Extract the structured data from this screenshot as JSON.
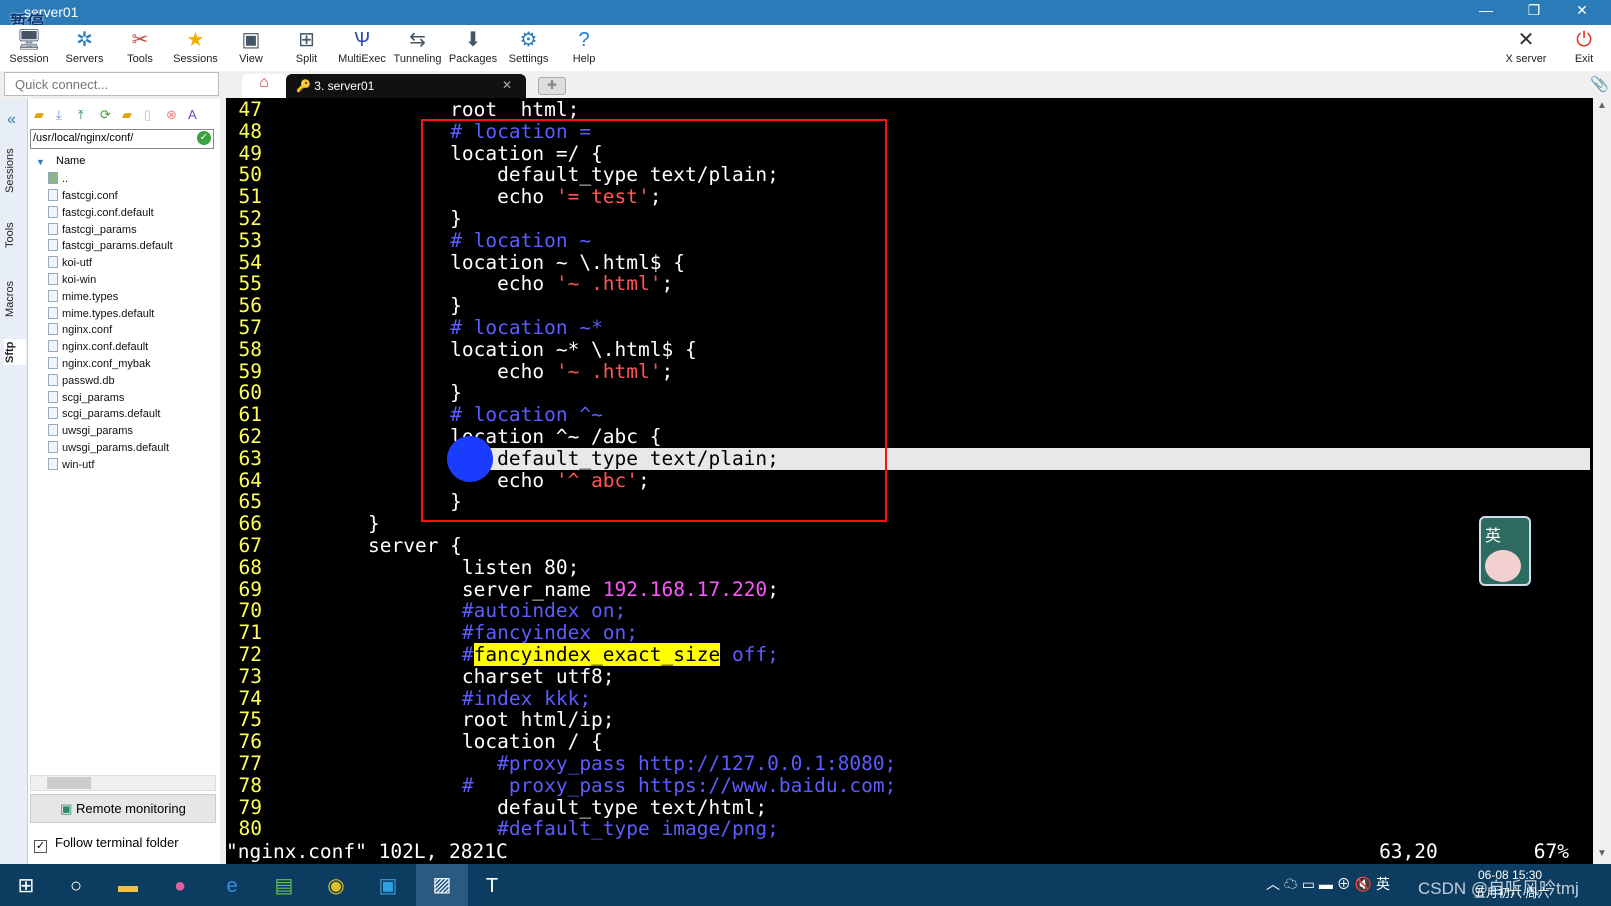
{
  "window": {
    "title": "server01",
    "overlay": "暂停"
  },
  "toolbar": {
    "items": [
      {
        "label": "Session",
        "icon": "session-icon"
      },
      {
        "label": "Servers",
        "icon": "servers-icon"
      },
      {
        "label": "Tools",
        "icon": "tools-icon"
      },
      {
        "label": "Sessions",
        "icon": "star-icon"
      },
      {
        "label": "View",
        "icon": "view-icon"
      },
      {
        "label": "Split",
        "icon": "split-icon"
      },
      {
        "label": "MultiExec",
        "icon": "multiexec-icon"
      },
      {
        "label": "Tunneling",
        "icon": "tunneling-icon"
      },
      {
        "label": "Packages",
        "icon": "packages-icon"
      },
      {
        "label": "Settings",
        "icon": "gear-icon"
      },
      {
        "label": "Help",
        "icon": "help-icon"
      }
    ],
    "xserver": "X server",
    "exit": "Exit"
  },
  "quick_connect": {
    "placeholder": "Quick connect..."
  },
  "tabs": {
    "active": "3. server01"
  },
  "vtabs": [
    "Sessions",
    "Tools",
    "Macros",
    "Sftp"
  ],
  "sftp": {
    "path": "/usr/local/nginx/conf/",
    "column": "Name",
    "parent": "..",
    "files": [
      "fastcgi.conf",
      "fastcgi.conf.default",
      "fastcgi_params",
      "fastcgi_params.default",
      "koi-utf",
      "koi-win",
      "mime.types",
      "mime.types.default",
      "nginx.conf",
      "nginx.conf.default",
      "nginx.conf_mybak",
      "passwd.db",
      "scgi_params",
      "scgi_params.default",
      "uwsgi_params",
      "uwsgi_params.default",
      "win-utf"
    ],
    "remote_monitoring": "Remote monitoring",
    "follow_terminal": "Follow terminal folder",
    "follow_checked": true
  },
  "terminal": {
    "lines": [
      {
        "n": "47",
        "seg": [
          [
            "       root  html;",
            ""
          ]
        ]
      },
      {
        "n": "48",
        "seg": [
          [
            "       ",
            ""
          ],
          [
            "# location =",
            "c"
          ]
        ]
      },
      {
        "n": "49",
        "seg": [
          [
            "       location =/ {",
            ""
          ]
        ]
      },
      {
        "n": "50",
        "seg": [
          [
            "           default_type text/plain;",
            ""
          ]
        ]
      },
      {
        "n": "51",
        "seg": [
          [
            "           echo ",
            ""
          ],
          [
            "'= test'",
            "s"
          ],
          [
            ";",
            ""
          ]
        ]
      },
      {
        "n": "52",
        "seg": [
          [
            "       }",
            ""
          ]
        ]
      },
      {
        "n": "53",
        "seg": [
          [
            "       ",
            ""
          ],
          [
            "# location ~",
            "c"
          ]
        ]
      },
      {
        "n": "54",
        "seg": [
          [
            "       location ~ \\.html$ {",
            ""
          ]
        ]
      },
      {
        "n": "55",
        "seg": [
          [
            "           echo ",
            ""
          ],
          [
            "'~ .html'",
            "s"
          ],
          [
            ";",
            ""
          ]
        ]
      },
      {
        "n": "56",
        "seg": [
          [
            "       }",
            ""
          ]
        ]
      },
      {
        "n": "57",
        "seg": [
          [
            "       ",
            ""
          ],
          [
            "# location ~*",
            "c"
          ]
        ]
      },
      {
        "n": "58",
        "seg": [
          [
            "       location ~* \\.html$ {",
            ""
          ]
        ]
      },
      {
        "n": "59",
        "seg": [
          [
            "           echo ",
            ""
          ],
          [
            "'~ .html'",
            "s"
          ],
          [
            ";",
            ""
          ]
        ]
      },
      {
        "n": "60",
        "seg": [
          [
            "       }",
            ""
          ]
        ]
      },
      {
        "n": "61",
        "seg": [
          [
            "       ",
            ""
          ],
          [
            "# location ^~",
            "c"
          ]
        ]
      },
      {
        "n": "62",
        "seg": [
          [
            "       location ^~ /abc {",
            ""
          ]
        ]
      },
      {
        "n": "63",
        "seg": [
          [
            "           default_type text/plain;",
            ""
          ]
        ],
        "cursor": true
      },
      {
        "n": "64",
        "seg": [
          [
            "           echo ",
            ""
          ],
          [
            "'^ abc'",
            "s"
          ],
          [
            ";",
            ""
          ]
        ]
      },
      {
        "n": "65",
        "seg": [
          [
            "       }",
            ""
          ]
        ]
      },
      {
        "n": "66",
        "seg": [
          [
            "}",
            ""
          ]
        ]
      },
      {
        "n": "67",
        "seg": [
          [
            "server {",
            ""
          ]
        ]
      },
      {
        "n": "68",
        "seg": [
          [
            "        listen 80;",
            ""
          ]
        ]
      },
      {
        "n": "69",
        "seg": [
          [
            "        server_name ",
            ""
          ],
          [
            "192.168.17.220",
            "m"
          ],
          [
            ";",
            ""
          ]
        ]
      },
      {
        "n": "70",
        "seg": [
          [
            "        ",
            ""
          ],
          [
            "#autoindex on;",
            "c"
          ]
        ]
      },
      {
        "n": "71",
        "seg": [
          [
            "        ",
            ""
          ],
          [
            "#fancyindex on;",
            "c"
          ]
        ]
      },
      {
        "n": "72",
        "seg": [
          [
            "        ",
            ""
          ],
          [
            "#",
            "c"
          ],
          [
            "fancyindex_exact_size",
            "y"
          ],
          [
            " off;",
            "c"
          ]
        ]
      },
      {
        "n": "73",
        "seg": [
          [
            "        charset utf8;",
            ""
          ]
        ]
      },
      {
        "n": "74",
        "seg": [
          [
            "        ",
            ""
          ],
          [
            "#index kkk;",
            "c"
          ]
        ]
      },
      {
        "n": "75",
        "seg": [
          [
            "        root html/ip;",
            ""
          ]
        ]
      },
      {
        "n": "76",
        "seg": [
          [
            "        location / {",
            ""
          ]
        ]
      },
      {
        "n": "77",
        "seg": [
          [
            "           ",
            ""
          ],
          [
            "#proxy_pass http://127.0.0.1:8080;",
            "c"
          ]
        ]
      },
      {
        "n": "78",
        "seg": [
          [
            "        ",
            ""
          ],
          [
            "#   proxy_pass https://www.baidu.com;",
            "c"
          ]
        ]
      },
      {
        "n": "79",
        "seg": [
          [
            "           default_type text/html;",
            ""
          ]
        ]
      },
      {
        "n": "80",
        "seg": [
          [
            "           ",
            ""
          ],
          [
            "#default_type image/png;",
            "c"
          ]
        ]
      }
    ],
    "status_file": "\"nginx.conf\" 102L, 2821C",
    "status_pos": "63,20",
    "status_pct": "67%"
  },
  "ime": "英",
  "tray": {
    "clock": "06-08 15:30",
    "date": "五月初六 周六",
    "watermark": "CSDN @自听风吟tmj"
  },
  "colors": {
    "titlebar": "#2b7bb9",
    "comment": "#5c5cff",
    "string": "#ff5555",
    "ip": "#ff55ff",
    "highlight": "#ffff00",
    "linenum": "#ffff55",
    "annotation_box": "#ff1010"
  }
}
